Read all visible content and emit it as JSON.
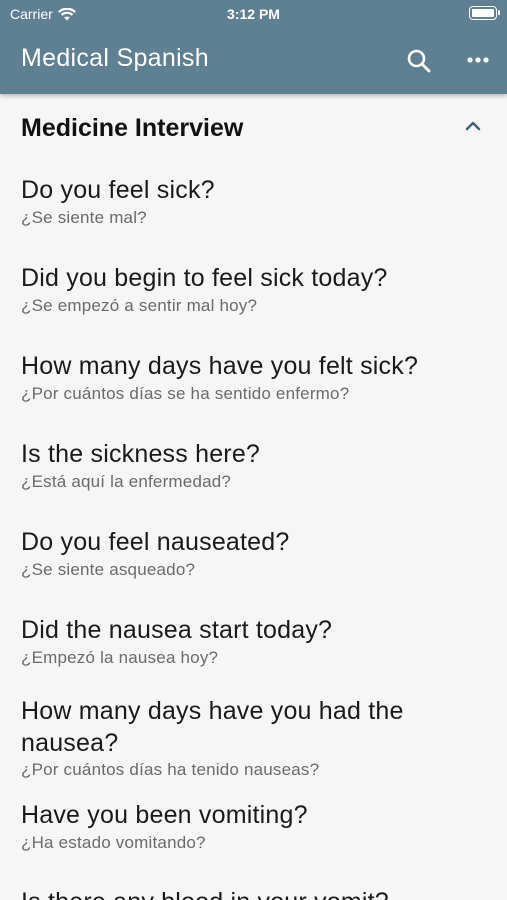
{
  "status": {
    "carrier": "Carrier",
    "time": "3:12 PM"
  },
  "appbar": {
    "title": "Medical Spanish",
    "search_icon": "search-icon",
    "more_icon": "more-horizontal-icon",
    "color": "#5f7f93"
  },
  "section": {
    "title": "Medicine Interview",
    "expanded": true
  },
  "items": [
    {
      "en": "Do you feel sick?",
      "es": "¿Se siente mal?"
    },
    {
      "en": "Did you begin to feel sick today?",
      "es": "¿Se empezó a sentir mal hoy?"
    },
    {
      "en": "How many days have you felt sick?",
      "es": "¿Por cuántos días se ha sentido enfermo?"
    },
    {
      "en": "Is the sickness here?",
      "es": "¿Está aquí la enfermedad?"
    },
    {
      "en": "Do you feel nauseated?",
      "es": "¿Se siente asqueado?"
    },
    {
      "en": "Did the nausea start today?",
      "es": "¿Empezó la nausea hoy?"
    },
    {
      "en": "How many days have you had the nausea?",
      "es": "¿Por cuántos días ha tenido nauseas?"
    },
    {
      "en": "Have you been vomiting?",
      "es": "¿Ha estado vomitando?"
    },
    {
      "en": "Is there any blood in your vomit?",
      "es": ""
    }
  ]
}
